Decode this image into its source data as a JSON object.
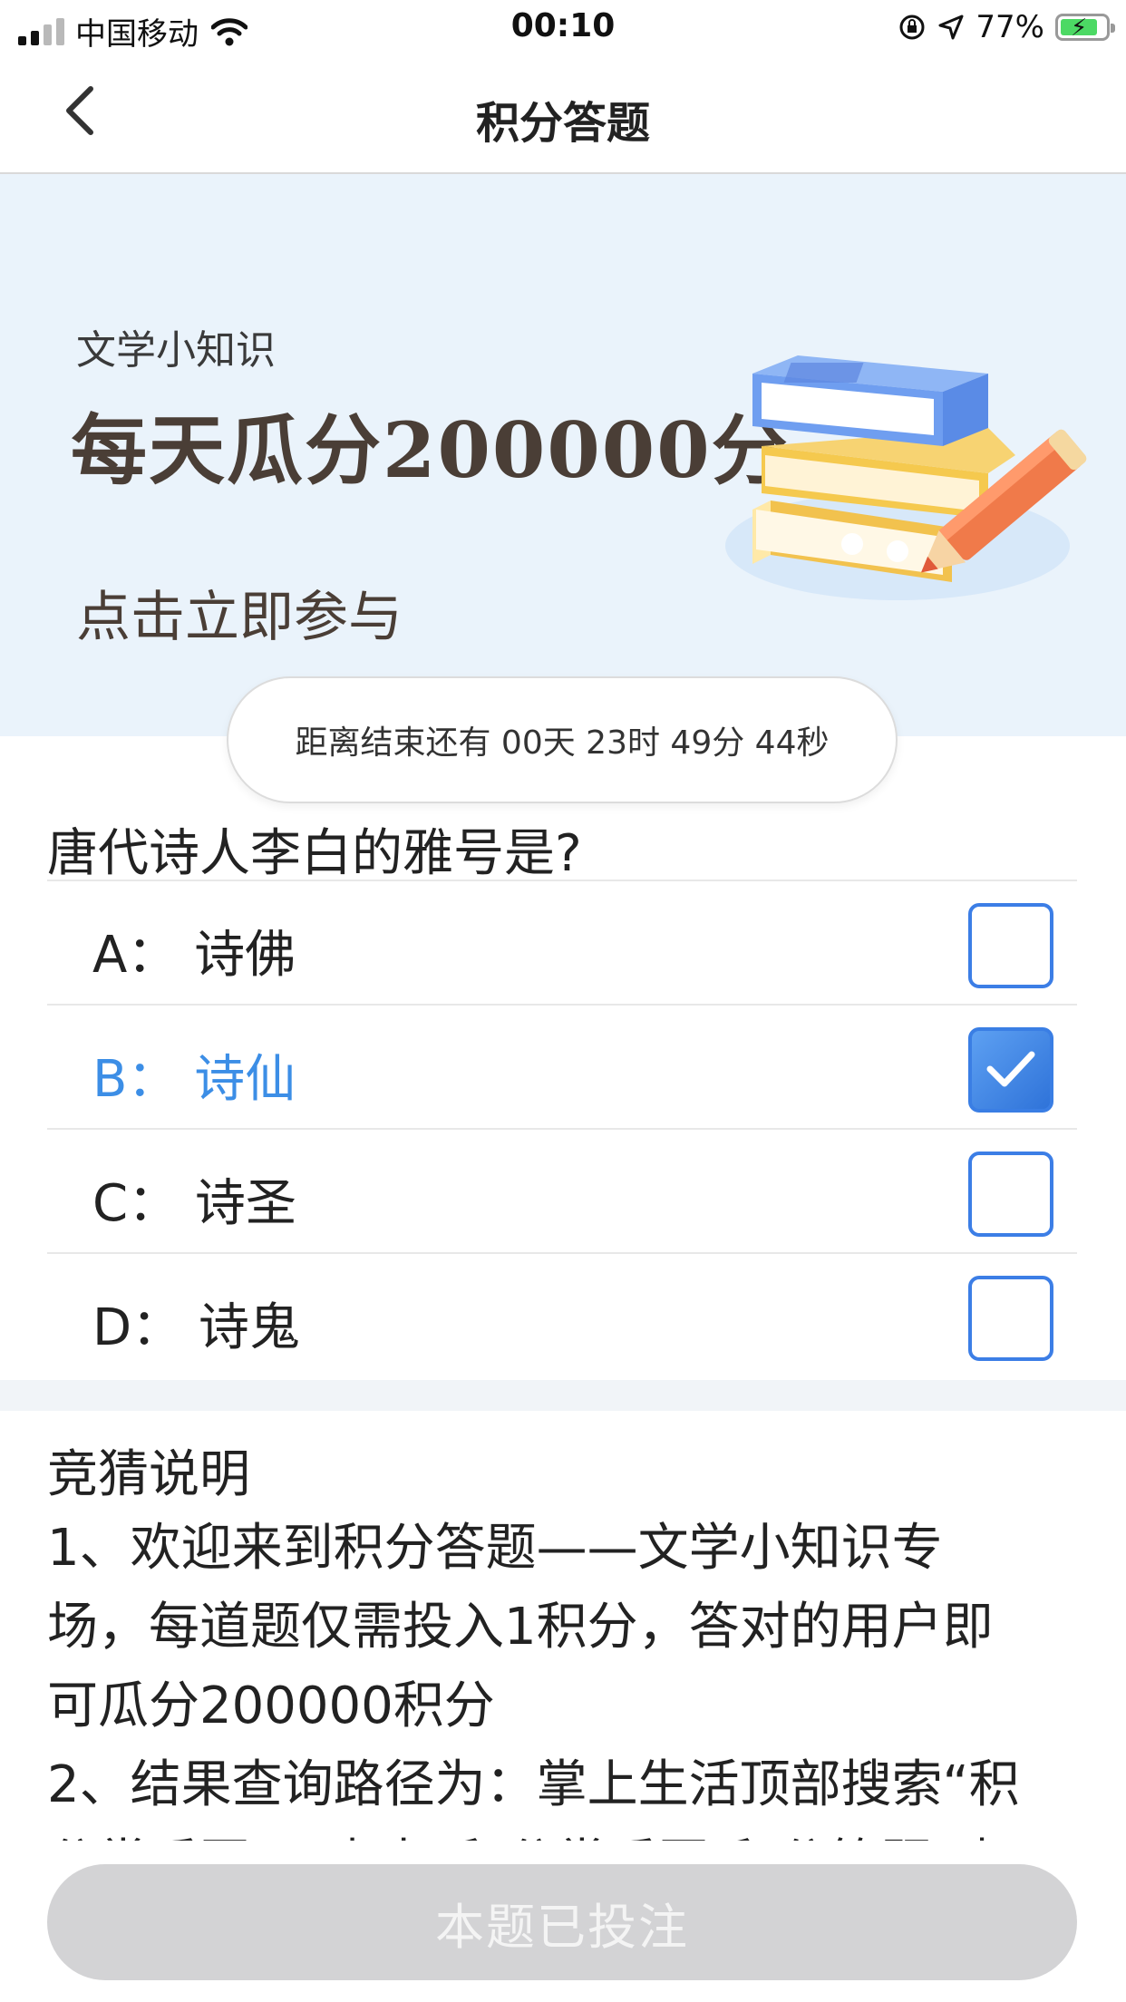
{
  "status_bar": {
    "carrier": "中国移动",
    "time": "00:10",
    "battery_percent": "77%",
    "icons": [
      "signal-icon",
      "wifi-icon",
      "orientation-lock-icon",
      "location-icon",
      "battery-charging-icon"
    ]
  },
  "nav": {
    "title": "积分答题",
    "back_icon": "chevron-left-icon"
  },
  "banner": {
    "subtitle": "文学小知识",
    "headline": "每天瓜分200000分",
    "cta": "点击立即参与",
    "background_color": "#eaf3fb",
    "illustration_icon": "books-pencil-illustration"
  },
  "countdown": {
    "text": "距离结束还有 00天 23时 49分 44秒"
  },
  "question": {
    "text": "唐代诗人李白的雅号是?",
    "options": [
      {
        "label": "A： 诗佛",
        "selected": false
      },
      {
        "label": "B： 诗仙",
        "selected": true
      },
      {
        "label": "C： 诗圣",
        "selected": false
      },
      {
        "label": "D： 诗鬼",
        "selected": false
      }
    ],
    "accent_color": "#3c8ee6"
  },
  "rules": {
    "title": "竞猜说明",
    "lines": [
      "1、欢迎来到积分答题——文学小知识专",
      "场，每道题仅需投入1积分，答对的用户即",
      "可瓜分200000积分",
      "2、结果查询路径为：掌上生活顶部搜索“积",
      "分掌乐园”，点击“积分掌乐园-积分答题”查"
    ]
  },
  "footer": {
    "button_label": "本题已投注",
    "button_color": "#d3d3d5"
  }
}
